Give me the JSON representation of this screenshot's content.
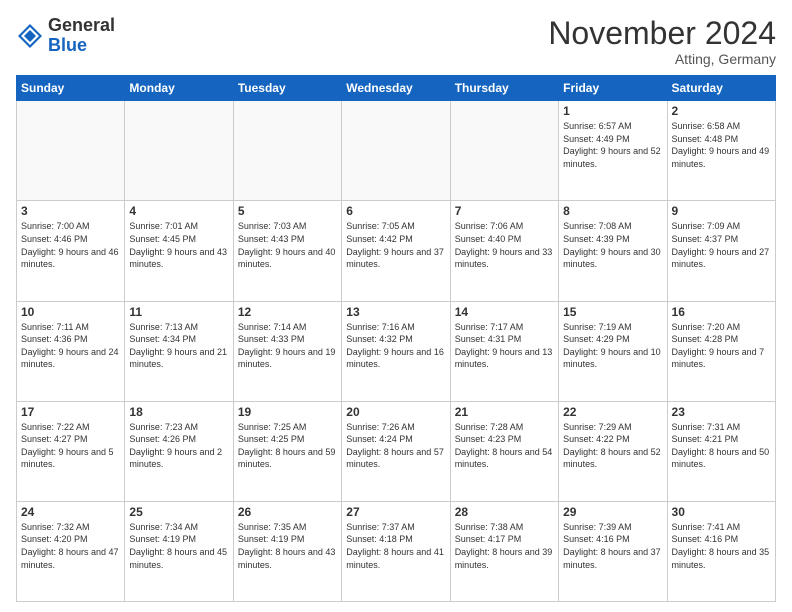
{
  "header": {
    "logo_general": "General",
    "logo_blue": "Blue",
    "month_title": "November 2024",
    "location": "Atting, Germany"
  },
  "weekdays": [
    "Sunday",
    "Monday",
    "Tuesday",
    "Wednesday",
    "Thursday",
    "Friday",
    "Saturday"
  ],
  "weeks": [
    [
      {
        "day": "",
        "empty": true
      },
      {
        "day": "",
        "empty": true
      },
      {
        "day": "",
        "empty": true
      },
      {
        "day": "",
        "empty": true
      },
      {
        "day": "",
        "empty": true
      },
      {
        "day": "1",
        "sunrise": "Sunrise: 6:57 AM",
        "sunset": "Sunset: 4:49 PM",
        "daylight": "Daylight: 9 hours and 52 minutes."
      },
      {
        "day": "2",
        "sunrise": "Sunrise: 6:58 AM",
        "sunset": "Sunset: 4:48 PM",
        "daylight": "Daylight: 9 hours and 49 minutes."
      }
    ],
    [
      {
        "day": "3",
        "sunrise": "Sunrise: 7:00 AM",
        "sunset": "Sunset: 4:46 PM",
        "daylight": "Daylight: 9 hours and 46 minutes."
      },
      {
        "day": "4",
        "sunrise": "Sunrise: 7:01 AM",
        "sunset": "Sunset: 4:45 PM",
        "daylight": "Daylight: 9 hours and 43 minutes."
      },
      {
        "day": "5",
        "sunrise": "Sunrise: 7:03 AM",
        "sunset": "Sunset: 4:43 PM",
        "daylight": "Daylight: 9 hours and 40 minutes."
      },
      {
        "day": "6",
        "sunrise": "Sunrise: 7:05 AM",
        "sunset": "Sunset: 4:42 PM",
        "daylight": "Daylight: 9 hours and 37 minutes."
      },
      {
        "day": "7",
        "sunrise": "Sunrise: 7:06 AM",
        "sunset": "Sunset: 4:40 PM",
        "daylight": "Daylight: 9 hours and 33 minutes."
      },
      {
        "day": "8",
        "sunrise": "Sunrise: 7:08 AM",
        "sunset": "Sunset: 4:39 PM",
        "daylight": "Daylight: 9 hours and 30 minutes."
      },
      {
        "day": "9",
        "sunrise": "Sunrise: 7:09 AM",
        "sunset": "Sunset: 4:37 PM",
        "daylight": "Daylight: 9 hours and 27 minutes."
      }
    ],
    [
      {
        "day": "10",
        "sunrise": "Sunrise: 7:11 AM",
        "sunset": "Sunset: 4:36 PM",
        "daylight": "Daylight: 9 hours and 24 minutes."
      },
      {
        "day": "11",
        "sunrise": "Sunrise: 7:13 AM",
        "sunset": "Sunset: 4:34 PM",
        "daylight": "Daylight: 9 hours and 21 minutes."
      },
      {
        "day": "12",
        "sunrise": "Sunrise: 7:14 AM",
        "sunset": "Sunset: 4:33 PM",
        "daylight": "Daylight: 9 hours and 19 minutes."
      },
      {
        "day": "13",
        "sunrise": "Sunrise: 7:16 AM",
        "sunset": "Sunset: 4:32 PM",
        "daylight": "Daylight: 9 hours and 16 minutes."
      },
      {
        "day": "14",
        "sunrise": "Sunrise: 7:17 AM",
        "sunset": "Sunset: 4:31 PM",
        "daylight": "Daylight: 9 hours and 13 minutes."
      },
      {
        "day": "15",
        "sunrise": "Sunrise: 7:19 AM",
        "sunset": "Sunset: 4:29 PM",
        "daylight": "Daylight: 9 hours and 10 minutes."
      },
      {
        "day": "16",
        "sunrise": "Sunrise: 7:20 AM",
        "sunset": "Sunset: 4:28 PM",
        "daylight": "Daylight: 9 hours and 7 minutes."
      }
    ],
    [
      {
        "day": "17",
        "sunrise": "Sunrise: 7:22 AM",
        "sunset": "Sunset: 4:27 PM",
        "daylight": "Daylight: 9 hours and 5 minutes."
      },
      {
        "day": "18",
        "sunrise": "Sunrise: 7:23 AM",
        "sunset": "Sunset: 4:26 PM",
        "daylight": "Daylight: 9 hours and 2 minutes."
      },
      {
        "day": "19",
        "sunrise": "Sunrise: 7:25 AM",
        "sunset": "Sunset: 4:25 PM",
        "daylight": "Daylight: 8 hours and 59 minutes."
      },
      {
        "day": "20",
        "sunrise": "Sunrise: 7:26 AM",
        "sunset": "Sunset: 4:24 PM",
        "daylight": "Daylight: 8 hours and 57 minutes."
      },
      {
        "day": "21",
        "sunrise": "Sunrise: 7:28 AM",
        "sunset": "Sunset: 4:23 PM",
        "daylight": "Daylight: 8 hours and 54 minutes."
      },
      {
        "day": "22",
        "sunrise": "Sunrise: 7:29 AM",
        "sunset": "Sunset: 4:22 PM",
        "daylight": "Daylight: 8 hours and 52 minutes."
      },
      {
        "day": "23",
        "sunrise": "Sunrise: 7:31 AM",
        "sunset": "Sunset: 4:21 PM",
        "daylight": "Daylight: 8 hours and 50 minutes."
      }
    ],
    [
      {
        "day": "24",
        "sunrise": "Sunrise: 7:32 AM",
        "sunset": "Sunset: 4:20 PM",
        "daylight": "Daylight: 8 hours and 47 minutes."
      },
      {
        "day": "25",
        "sunrise": "Sunrise: 7:34 AM",
        "sunset": "Sunset: 4:19 PM",
        "daylight": "Daylight: 8 hours and 45 minutes."
      },
      {
        "day": "26",
        "sunrise": "Sunrise: 7:35 AM",
        "sunset": "Sunset: 4:19 PM",
        "daylight": "Daylight: 8 hours and 43 minutes."
      },
      {
        "day": "27",
        "sunrise": "Sunrise: 7:37 AM",
        "sunset": "Sunset: 4:18 PM",
        "daylight": "Daylight: 8 hours and 41 minutes."
      },
      {
        "day": "28",
        "sunrise": "Sunrise: 7:38 AM",
        "sunset": "Sunset: 4:17 PM",
        "daylight": "Daylight: 8 hours and 39 minutes."
      },
      {
        "day": "29",
        "sunrise": "Sunrise: 7:39 AM",
        "sunset": "Sunset: 4:16 PM",
        "daylight": "Daylight: 8 hours and 37 minutes."
      },
      {
        "day": "30",
        "sunrise": "Sunrise: 7:41 AM",
        "sunset": "Sunset: 4:16 PM",
        "daylight": "Daylight: 8 hours and 35 minutes."
      }
    ]
  ]
}
